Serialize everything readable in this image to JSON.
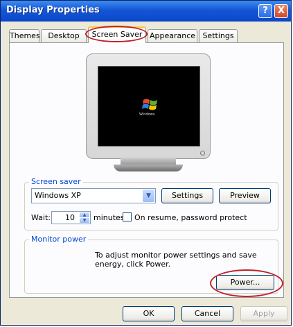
{
  "window": {
    "title": "Display Properties"
  },
  "titlebar": {
    "help_label": "?",
    "close_label": "X"
  },
  "tabs": [
    {
      "label": "Themes"
    },
    {
      "label": "Desktop"
    },
    {
      "label": "Screen Saver",
      "active": true
    },
    {
      "label": "Appearance"
    },
    {
      "label": "Settings"
    }
  ],
  "preview": {
    "logo_text": "Windows"
  },
  "screen_saver": {
    "group_label": "Screen saver",
    "selected": "Windows XP",
    "settings_label": "Settings",
    "preview_label": "Preview",
    "wait_label": "Wait:",
    "wait_value": "10",
    "minutes_label": "minutes",
    "password_label": "On resume, password protect"
  },
  "monitor_power": {
    "group_label": "Monitor power",
    "description": "To adjust monitor power settings and save energy, click Power.",
    "power_label": "Power..."
  },
  "footer": {
    "ok_label": "OK",
    "cancel_label": "Cancel",
    "apply_label": "Apply"
  },
  "colors": {
    "title_bar": "#1456d6",
    "group_label": "#0046d5",
    "highlight": "#c0202a",
    "tab_accent": "#ffc83c"
  }
}
